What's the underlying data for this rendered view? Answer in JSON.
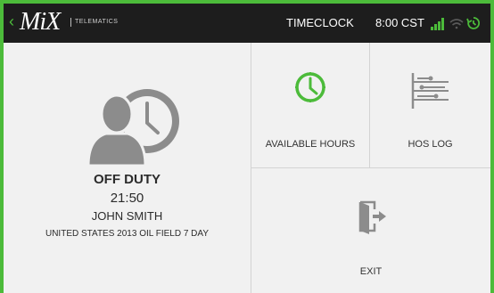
{
  "header": {
    "logo_text": "MiX",
    "logo_sub": "TELEMATICS",
    "title": "TIMECLOCK",
    "time": "8:00 CST"
  },
  "status": {
    "duty": "OFF DUTY",
    "time": "21:50",
    "driver": "JOHN SMITH",
    "ruleset": "UNITED STATES 2013 OIL FIELD 7 DAY"
  },
  "tiles": {
    "available_hours": "AVAILABLE HOURS",
    "hos_log": "HOS LOG",
    "exit": "EXIT"
  },
  "colors": {
    "accent_green": "#4cbb3a",
    "topbar": "#1d1d1d",
    "icon_gray": "#8c8c8c"
  },
  "icons": [
    "back-chevron-icon",
    "signal-icon",
    "wifi-icon",
    "sync-icon",
    "driver-clock-icon",
    "clock-icon",
    "hos-log-icon",
    "exit-door-icon"
  ]
}
